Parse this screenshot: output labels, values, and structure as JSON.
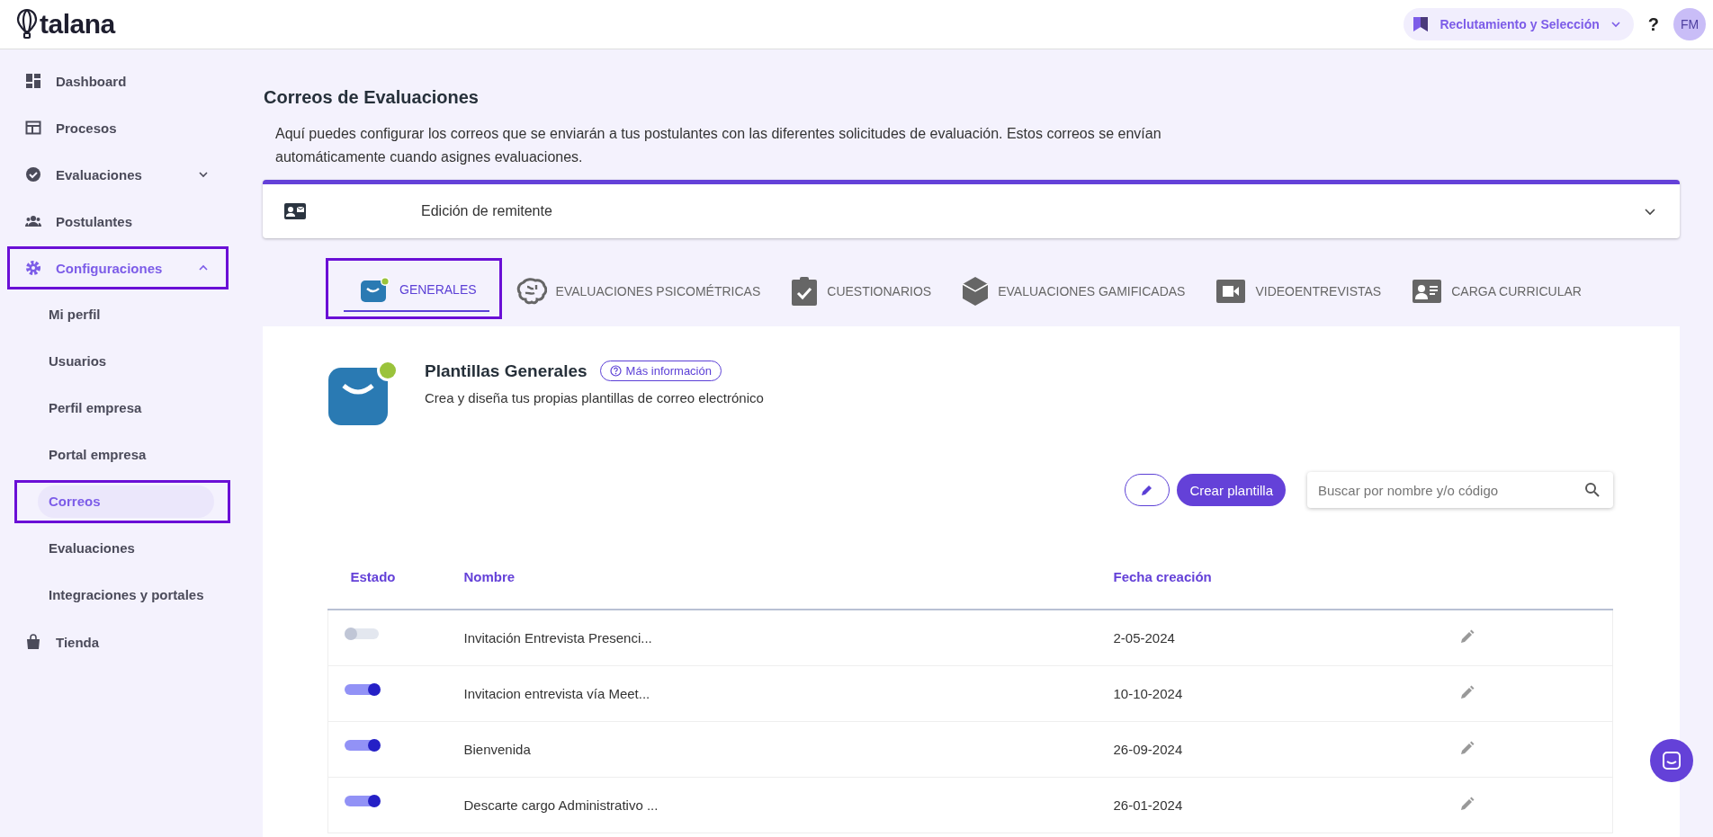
{
  "header": {
    "logo": "talana",
    "module": "Reclutamiento y Selección",
    "help": "?",
    "avatar": "FM"
  },
  "sidebar": {
    "items": [
      {
        "label": "Dashboard",
        "selected": false,
        "highlighted": false
      },
      {
        "label": "Procesos",
        "selected": false,
        "highlighted": false
      },
      {
        "label": "Evaluaciones",
        "selected": false,
        "highlighted": false,
        "expanded": false
      },
      {
        "label": "Postulantes",
        "selected": false,
        "highlighted": false
      },
      {
        "label": "Configuraciones",
        "selected": true,
        "highlighted": true,
        "expanded": true,
        "children": [
          {
            "label": "Mi perfil",
            "selected": false,
            "highlighted": false
          },
          {
            "label": "Usuarios",
            "selected": false,
            "highlighted": false
          },
          {
            "label": "Perfil empresa",
            "selected": false,
            "highlighted": false
          },
          {
            "label": "Portal empresa",
            "selected": false,
            "highlighted": false
          },
          {
            "label": "Correos",
            "selected": true,
            "highlighted": true
          },
          {
            "label": "Evaluaciones",
            "selected": false,
            "highlighted": false
          },
          {
            "label": "Integraciones y portales",
            "selected": false,
            "highlighted": false
          }
        ]
      },
      {
        "label": "Tienda",
        "selected": false,
        "highlighted": false
      }
    ]
  },
  "page": {
    "title": "Correos de Evaluaciones",
    "description": "Aquí puedes configurar los correos que se enviarán a tus postulantes con las diferentes solicitudes de evaluación. Estos correos se envían automáticamente cuando asignes evaluaciones.",
    "sender_panel": {
      "label": "Edición de remitente",
      "expanded": false
    }
  },
  "tabs": [
    {
      "label": "GENERALES",
      "selected": true,
      "highlighted": true
    },
    {
      "label": "EVALUACIONES PSICOMÉTRICAS",
      "selected": false,
      "highlighted": false
    },
    {
      "label": "CUESTIONARIOS",
      "selected": false,
      "highlighted": false
    },
    {
      "label": "EVALUACIONES GAMIFICADAS",
      "selected": false,
      "highlighted": false
    },
    {
      "label": "VIDEOENTREVISTAS",
      "selected": false,
      "highlighted": false
    },
    {
      "label": "CARGA CURRICULAR",
      "selected": false,
      "highlighted": false
    }
  ],
  "templates": {
    "title": "Plantillas Generales",
    "info_link": "Más información",
    "subtitle": "Crea y diseña tus propias plantillas de correo electrónico",
    "create_button": "Crear plantilla",
    "search": {
      "placeholder": "Buscar por nombre y/o código"
    },
    "table": {
      "columns": [
        "Estado",
        "Nombre",
        "Fecha creación"
      ],
      "rows": [
        {
          "on": false,
          "name": "Invitación Entrevista Presenci...",
          "date": "2-05-2024"
        },
        {
          "on": true,
          "name": "Invitacion entrevista vía Meet...",
          "date": "10-10-2024"
        },
        {
          "on": true,
          "name": "Bienvenida",
          "date": "26-09-2024"
        },
        {
          "on": true,
          "name": "Descarte cargo Administrativo ...",
          "date": "26-01-2024"
        }
      ]
    }
  }
}
